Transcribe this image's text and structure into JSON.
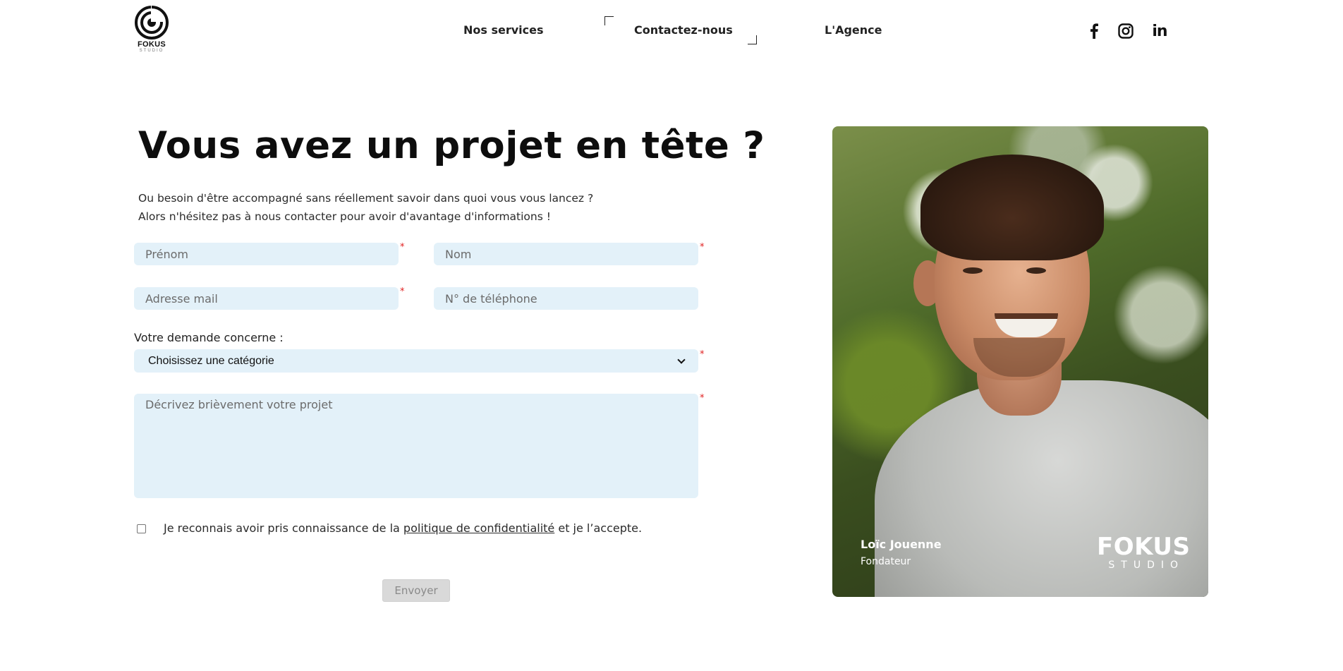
{
  "header": {
    "logo_text": "FOKUS",
    "logo_subtext": "STUDIO",
    "nav": [
      {
        "label": "Nos services"
      },
      {
        "label": "Contactez-nous"
      },
      {
        "label": "L'Agence"
      }
    ],
    "social_icons": [
      "facebook-icon",
      "instagram-icon",
      "linkedin-icon"
    ],
    "linkedin_glyph": "in"
  },
  "main": {
    "title": "Vous avez un projet en tête ?",
    "intro_line1": "Ou besoin d'être accompagné sans réellement savoir dans quoi vous vous lancez ?",
    "intro_line2": "Alors n'hésitez pas à nous contacter pour avoir d'avantage d'informations !"
  },
  "form": {
    "required_mark": "*",
    "prenom_placeholder": "Prénom",
    "nom_placeholder": "Nom",
    "mail_placeholder": "Adresse mail",
    "tel_placeholder": "N° de téléphone",
    "select_label": "Votre demande concerne :",
    "select_value": "Choisissez une catégorie",
    "desc_placeholder": "Décrivez brièvement votre projet",
    "consent_before": "Je reconnais avoir pris connaissance de la ",
    "consent_link": "politique de confidentialité",
    "consent_after": " et je l’accepte.",
    "submit_label": "Envoyer"
  },
  "photo_card": {
    "name": "Loïc Jouenne",
    "role": "Fondateur",
    "brand_main": "FOKUS",
    "brand_sub": "STUDIO"
  },
  "colors": {
    "field_bg": "#e3f1f9",
    "required": "#e02020",
    "submit_bg": "#d9d9d9"
  }
}
